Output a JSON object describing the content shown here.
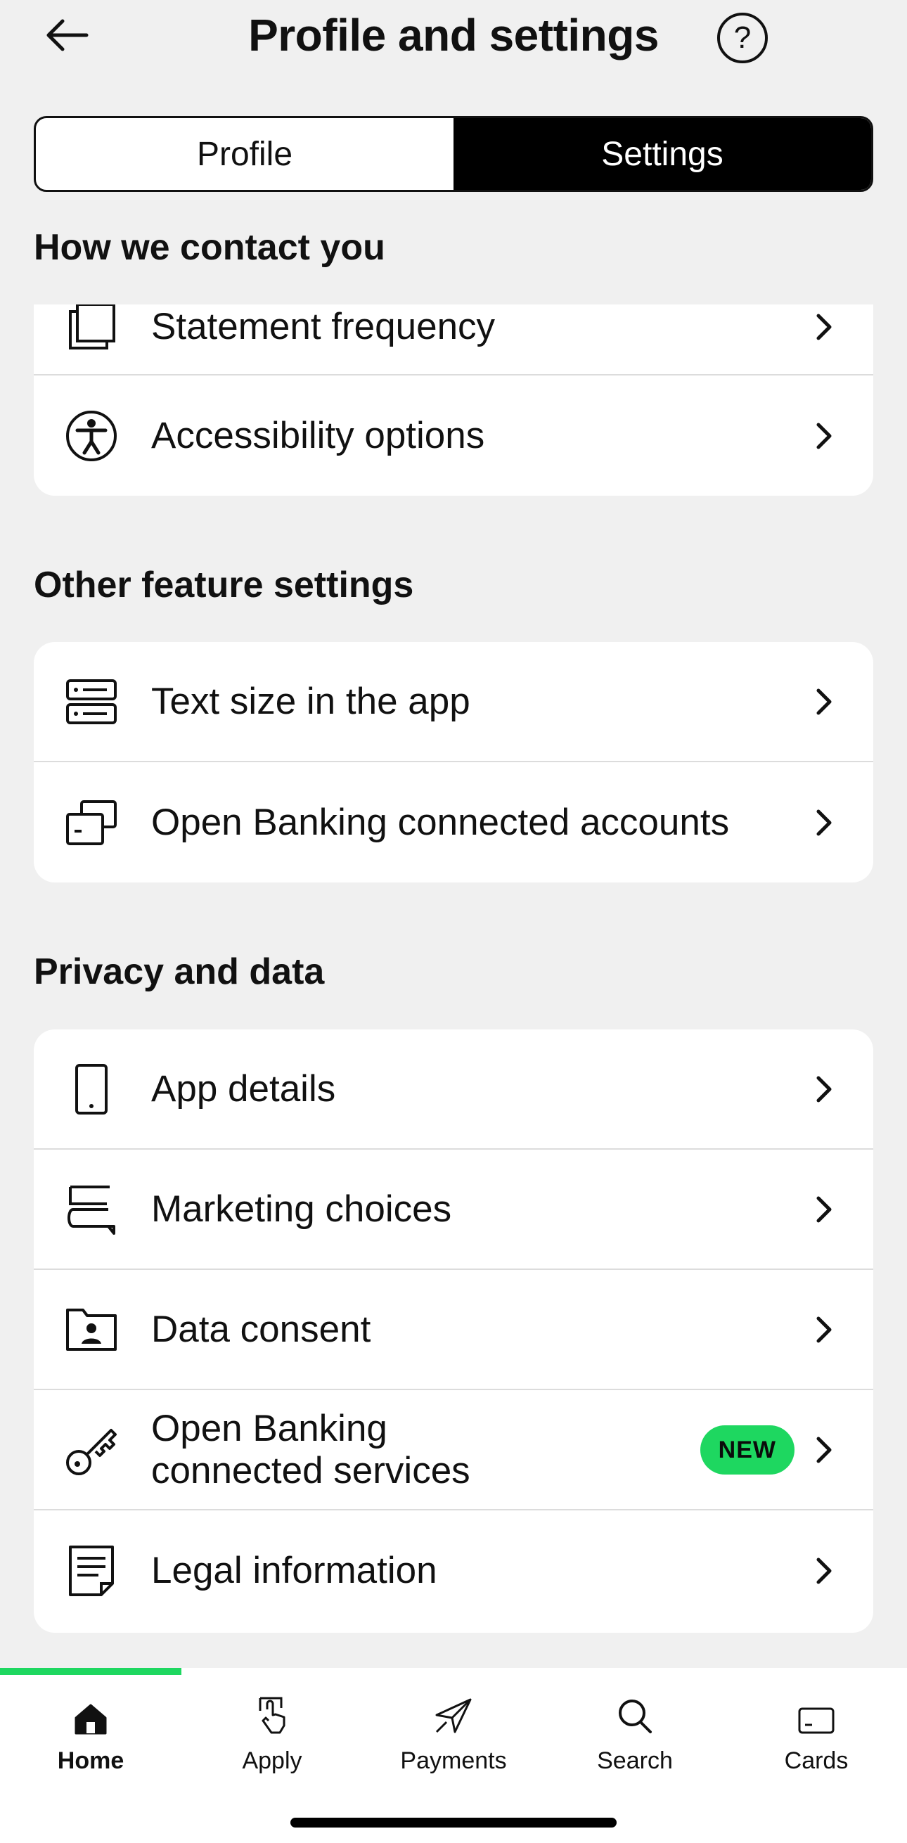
{
  "header": {
    "title": "Profile and settings",
    "help_symbol": "?"
  },
  "segmented": {
    "profile_label": "Profile",
    "settings_label": "Settings",
    "active": "Settings"
  },
  "sections": {
    "contact": {
      "title": "How we contact you",
      "items": [
        {
          "label": "Statement frequency",
          "icon": "statement-icon"
        },
        {
          "label": "Accessibility options",
          "icon": "accessibility-icon"
        }
      ]
    },
    "other": {
      "title": "Other feature settings",
      "items": [
        {
          "label": "Text size in the app",
          "icon": "text-size-icon"
        },
        {
          "label": "Open Banking connected accounts",
          "icon": "connected-accounts-icon"
        }
      ]
    },
    "privacy": {
      "title": "Privacy and data",
      "items": [
        {
          "label": "App details",
          "icon": "phone-icon"
        },
        {
          "label": "Marketing choices",
          "icon": "chat-icon"
        },
        {
          "label": "Data consent",
          "icon": "id-folder-icon"
        },
        {
          "label_line1": "Open Banking",
          "label_line2": "connected services",
          "badge": "NEW",
          "icon": "key-icon"
        },
        {
          "label": "Legal information",
          "icon": "document-icon"
        }
      ]
    }
  },
  "tabbar": {
    "tabs": [
      {
        "label": "Home",
        "icon": "home-icon",
        "active": true
      },
      {
        "label": "Apply",
        "icon": "apply-icon"
      },
      {
        "label": "Payments",
        "icon": "payments-icon"
      },
      {
        "label": "Search",
        "icon": "search-icon"
      },
      {
        "label": "Cards",
        "icon": "cards-icon"
      }
    ]
  },
  "colors": {
    "accent": "#1ed760",
    "background": "#f0f0f0",
    "active_segment": "#000000"
  }
}
